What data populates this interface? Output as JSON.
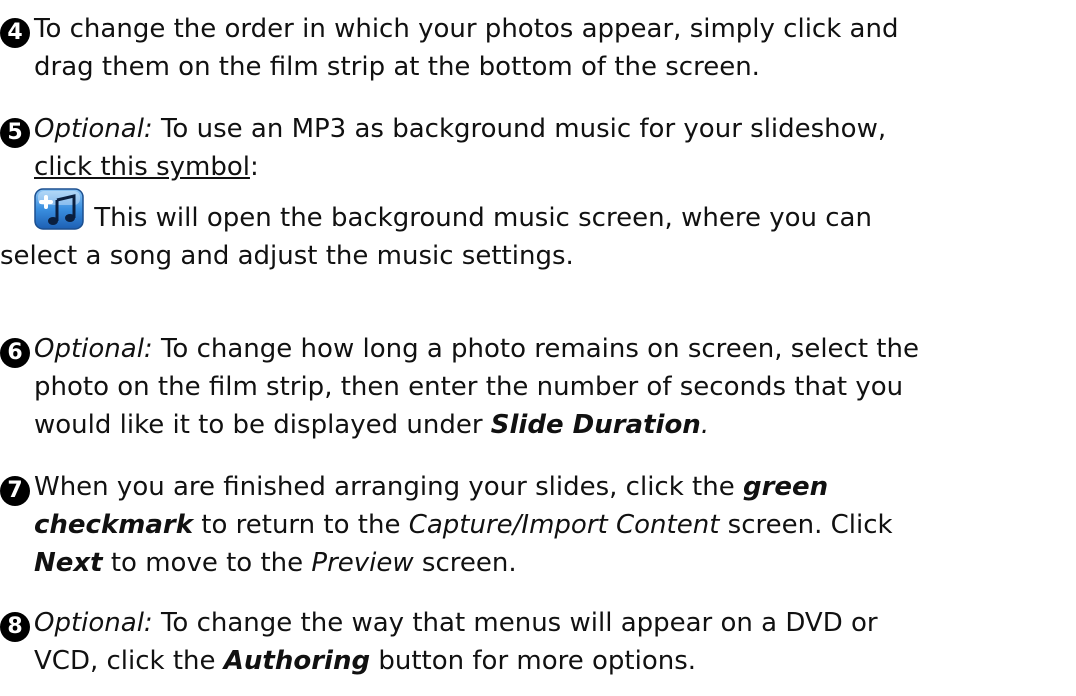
{
  "steps": [
    {
      "number": "4",
      "line1": "To change the order in which your photos appear, simply click and",
      "line2": "drag them on the film strip at the bottom of the screen."
    },
    {
      "number": "5",
      "optional": "Optional:",
      "line1": " To use an MP3 as background music for your slideshow,",
      "line2_link": "click this symbol",
      "line2_colon": ":",
      "line3": " This will open the background music screen, where you can",
      "line4": "select a song and adjust the music settings.",
      "icon": "add-music-icon"
    },
    {
      "number": "6",
      "optional": "Optional:",
      "line1": " To change how long a photo remains on screen, select the",
      "line2": "photo on the film strip, then enter the number of seconds that you",
      "line3_pre": "would like it to be displayed under ",
      "line3_bold": "Slide Duration",
      "line3_post": "."
    },
    {
      "number": "7",
      "line1_pre": "When you are finished arranging your slides, click the ",
      "line1_bold": "green",
      "line2_bold": "checkmark",
      "line2_mid": " to return to the ",
      "line2_em": "Capture/Import Content",
      "line2_post": " screen. Click",
      "line3_bold": "Next",
      "line3_mid": " to move to the ",
      "line3_em": "Preview",
      "line3_post": " screen."
    },
    {
      "number": "8",
      "optional": "Optional:",
      "line1": " To change the way that menus will appear on a DVD or",
      "line2_pre": "VCD, click the ",
      "line2_bold": "Authoring",
      "line2_post": " button for more options."
    }
  ],
  "colors": {
    "text": "#111111",
    "badge": "#000000",
    "icon_blue": "#2a7fd6"
  }
}
